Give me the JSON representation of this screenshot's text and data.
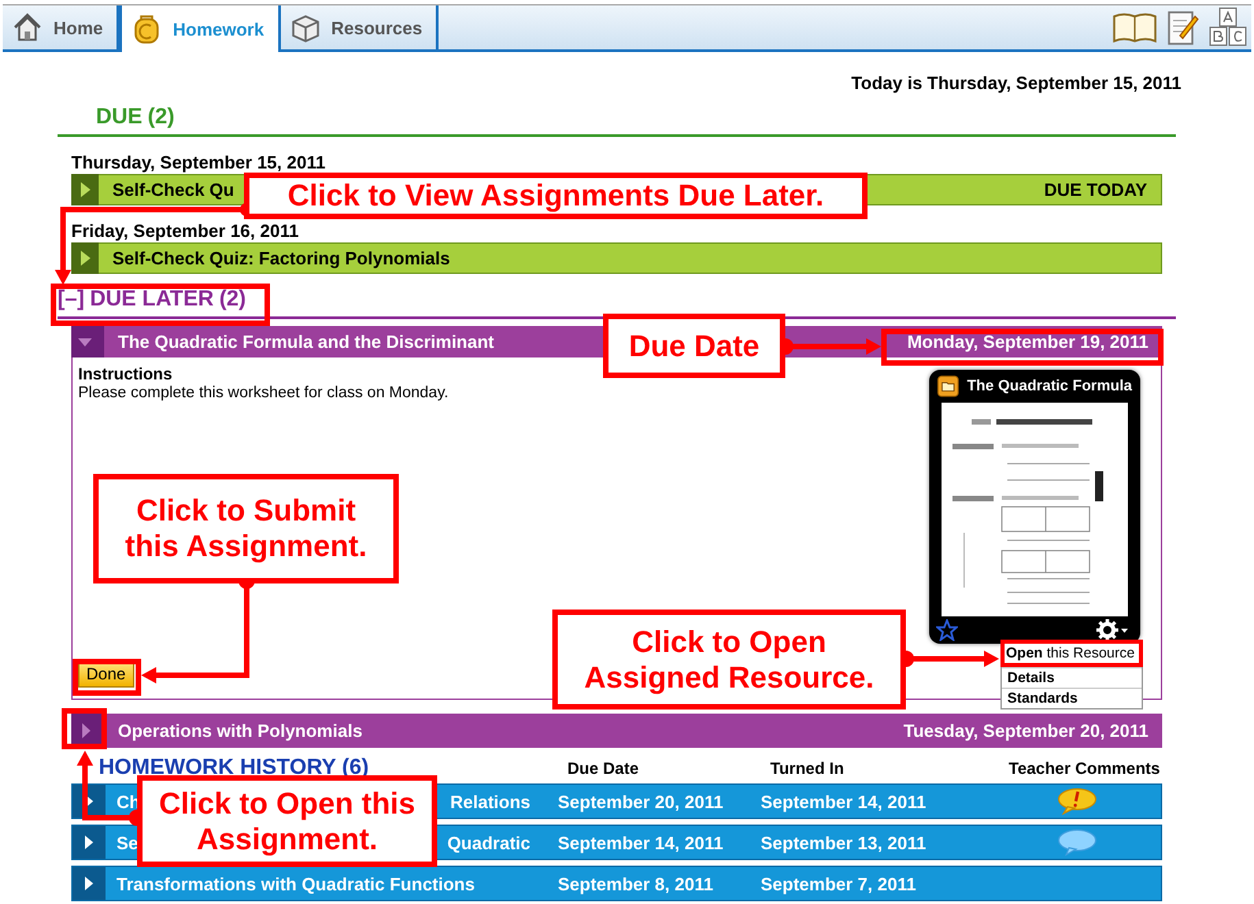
{
  "tabs": [
    {
      "label": "Home",
      "selected": false
    },
    {
      "label": "Homework",
      "selected": true
    },
    {
      "label": "Resources",
      "selected": false
    }
  ],
  "today": "Today is Thursday, September 15, 2011",
  "due": {
    "label": "DUE",
    "count": "(2)",
    "groups": [
      {
        "date": "Thursday, September 15, 2011",
        "items": [
          {
            "title": "Self-Check Qu",
            "tag": "DUE TODAY"
          }
        ]
      },
      {
        "date": "Friday, September 16, 2011",
        "items": [
          {
            "title": "Self-Check Quiz: Factoring Polynomials"
          }
        ]
      }
    ]
  },
  "due_later": {
    "toggle": "[–]",
    "label": "DUE LATER",
    "count": "(2)",
    "items": [
      {
        "title": "The Quadratic Formula and the Discriminant",
        "due": "Monday, September 19, 2011",
        "expanded": true,
        "instructions_label": "Instructions",
        "instructions": "Please complete this worksheet for class on Monday.",
        "done_button": "Done",
        "resource": {
          "title": "The Quadratic Formula",
          "menu": [
            {
              "label": "**Open** this Resource",
              "kind": "action"
            },
            {
              "label": "Details",
              "kind": "option"
            },
            {
              "label": "Standards",
              "kind": "option"
            }
          ]
        }
      },
      {
        "title": "Operations with Polynomials",
        "due": "Tuesday, September 20, 2011",
        "expanded": false
      }
    ]
  },
  "history": {
    "title": "HOMEWORK HISTORY (6)",
    "columns": [
      "Due Date",
      "Turned In",
      "Teacher Comments"
    ],
    "rows": [
      {
        "title": "Ch",
        "title_end": "Relations",
        "due": "September 20, 2011",
        "turned_in": "September 14, 2011",
        "kind": "alert"
      },
      {
        "title": "Se",
        "title_end": "Quadratic",
        "due": "September 14, 2011",
        "turned_in": "September 13, 2011",
        "kind": "message"
      },
      {
        "title": "Transformations with Quadratic Functions",
        "due": "September 8, 2011",
        "turned_in": "September 7, 2011"
      }
    ]
  },
  "callouts": [
    {
      "text": "Click to View Assignments Due Later."
    },
    {
      "text": "Due Date"
    },
    {
      "text": "Click to Submit this Assignment."
    },
    {
      "text": "Click to Open Assigned Resource."
    },
    {
      "text": "Click to Open this Assignment."
    }
  ]
}
